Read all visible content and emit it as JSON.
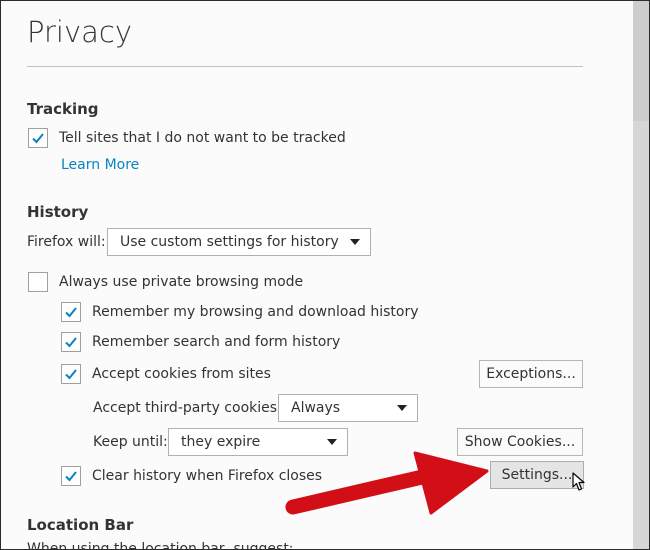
{
  "page": {
    "title": "Privacy"
  },
  "tracking": {
    "heading": "Tracking",
    "dnt_label": "Tell sites that I do not want to be tracked",
    "dnt_checked": true,
    "learn_more": "Learn More"
  },
  "history": {
    "heading": "History",
    "firefox_will_label": "Firefox will:",
    "firefox_will_value": "Use custom settings for history",
    "private_label": "Always use private browsing mode",
    "remember_browsing_label": "Remember my browsing and download history",
    "remember_search_label": "Remember search and form history",
    "accept_cookies_label": "Accept cookies from sites",
    "exceptions_button": "Exceptions...",
    "third_party_label": "Accept third-party cookies:",
    "third_party_value": "Always",
    "keep_until_label": "Keep until:",
    "keep_until_value": "they expire",
    "show_cookies_button": "Show Cookies...",
    "clear_history_label": "Clear history when Firefox closes",
    "settings_button": "Settings..."
  },
  "location_bar": {
    "heading": "Location Bar",
    "subtext": "When using the location bar, suggest:"
  },
  "colors": {
    "accent": "#0a84c1",
    "annotation_arrow": "#e8121b"
  },
  "icons": {
    "checkmark": "checkmark-icon",
    "caret": "chevron-down-icon",
    "cursor": "mouse-pointer-icon",
    "arrow": "red-arrow-annotation"
  }
}
